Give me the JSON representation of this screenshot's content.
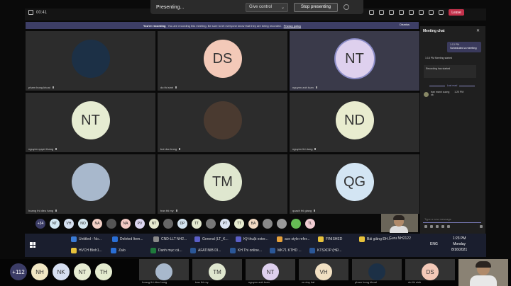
{
  "top": {
    "timer": "00:41",
    "presenting_label": "Presenting...",
    "give_control": "Give control",
    "stop_presenting": "Stop presenting",
    "leave": "Leave"
  },
  "banner": {
    "title": "You're recording",
    "text": "You are recording this meeting. Be sure to let everyone know that they are being recorded.",
    "policy_link": "Privacy policy",
    "dismiss": "Dismiss"
  },
  "tiles": [
    {
      "initials": "",
      "color": "#1c3046",
      "name": "pham hong khoai",
      "photo": true
    },
    {
      "initials": "DS",
      "color": "#f3c9b8",
      "name": "do thi sinh",
      "photo": false
    },
    {
      "initials": "NT",
      "color": "#ded0ee",
      "name": "nguyen anh tuan",
      "photo": false,
      "active": true
    },
    {
      "initials": "NT",
      "color": "#e6ecd2",
      "name": "nguyen quyet thang",
      "photo": false
    },
    {
      "initials": "",
      "color": "#4a3a30",
      "name": "bui duc trong",
      "photo": true
    },
    {
      "initials": "ND",
      "color": "#e9eccf",
      "name": "nguyen thi dung",
      "photo": false
    },
    {
      "initials": "",
      "color": "#a8b8cc",
      "name": "hoang thi dieu hang",
      "photo": true
    },
    {
      "initials": "TM",
      "color": "#dfe7cf",
      "name": "tran thi my",
      "photo": false
    },
    {
      "initials": "QG",
      "color": "#d3e5f3",
      "name": "quach thi giang",
      "photo": false
    }
  ],
  "strip": [
    {
      "t": "+34",
      "c": "#3b3c66"
    },
    {
      "t": "NT",
      "c": "#d3e8f3"
    },
    {
      "t": "VH",
      "c": "#d6e1f1"
    },
    {
      "t": "NO",
      "c": "#d5e8f0"
    },
    {
      "t": "NA",
      "c": "#f3d0c6"
    },
    {
      "t": "",
      "c": "#555"
    },
    {
      "t": "NA",
      "c": "#f2c9c4"
    },
    {
      "t": "PV",
      "c": "#dcd6f0"
    },
    {
      "t": "NT",
      "c": "#e6e9cf"
    },
    {
      "t": "",
      "c": "#666"
    },
    {
      "t": "DP",
      "c": "#d3e3ef"
    },
    {
      "t": "TT",
      "c": "#e3e9cf"
    },
    {
      "t": "",
      "c": "#777"
    },
    {
      "t": "PT",
      "c": "#dae2f1"
    },
    {
      "t": "TT",
      "c": "#e7ebcf"
    },
    {
      "t": "BA",
      "c": "#f1d9c2"
    },
    {
      "t": "",
      "c": "#888"
    },
    {
      "t": "",
      "c": "#999"
    },
    {
      "t": "",
      "c": "#6b5"
    },
    {
      "t": "TL",
      "c": "#f1cdd3"
    }
  ],
  "chat": {
    "title": "Meeting chat",
    "sched_time": "1:13 PM",
    "sched_text": "Scheduled a meeting",
    "started_time": "1:16 PM",
    "started_text": "Meeting started",
    "rec_text": "Recording has started",
    "last_read": "Last read",
    "msg_name": "tran manh cuong",
    "msg_time": "1:20 PM",
    "msg_text": "ok",
    "input_placeholder": "Type a new message"
  },
  "taskbar": [
    {
      "label": "Untitled - No...",
      "c": "#3a7bd5"
    },
    {
      "label": "Deleted Item...",
      "c": "#2a6fd6"
    },
    {
      "label": "CND-LLT NH2...",
      "c": "#8a8a8a"
    },
    {
      "label": "General (LT_K...",
      "c": "#5b5fc7"
    },
    {
      "label": "Kỹ thuật exter...",
      "c": "#5b5fc7"
    },
    {
      "label": "ace style refer...",
      "c": "#e7a23b"
    },
    {
      "label": "FINISHED",
      "c": "#e7c23b"
    },
    {
      "label": "Bài giảng ĐH...",
      "c": "#e7c23b"
    },
    {
      "label": "HVCH Bình1...",
      "c": "#e7c23b"
    },
    {
      "label": "Zalo",
      "c": "#2a6fd6"
    },
    {
      "label": "Danh mục cá...",
      "c": "#1f7a3c"
    },
    {
      "label": "AFATINIB DI...",
      "c": "#2b5797"
    },
    {
      "label": "KH Thi online...",
      "c": "#2b5797"
    },
    {
      "label": "MK71 KTHD ...",
      "c": "#2b5797"
    },
    {
      "label": "KTSXDP (HĐ...",
      "c": "#2b5797"
    }
  ],
  "taskbar_extra": "Guru NH2122",
  "tray": "ENG",
  "clock_time": "1:23 PM",
  "clock_day": "Monday",
  "clock_date": "8/16/2021",
  "bottom": [
    {
      "t": "+112",
      "c": "#3b3c66"
    },
    {
      "t": "NH",
      "c": "#f1e7c4"
    },
    {
      "t": "NK",
      "c": "#d6dff1"
    },
    {
      "t": "NT",
      "c": "#e6ecd2"
    },
    {
      "t": "TH",
      "c": "#e4ebcf"
    }
  ],
  "bottom_named": [
    {
      "t": "",
      "c": "#a8b8cc",
      "name": "hoang thi dieu hang"
    },
    {
      "t": "TM",
      "c": "#dfe7cf",
      "name": "tran thi my"
    },
    {
      "t": "NT",
      "c": "#ded0ee",
      "name": "nguyen anh tuan"
    },
    {
      "t": "VH",
      "c": "#f1e0c2",
      "name": "vu duy hai"
    },
    {
      "t": "",
      "c": "#1c3046",
      "name": "pham hong khoai"
    },
    {
      "t": "DS",
      "c": "#f3c9b8",
      "name": "do thi sinh"
    }
  ]
}
